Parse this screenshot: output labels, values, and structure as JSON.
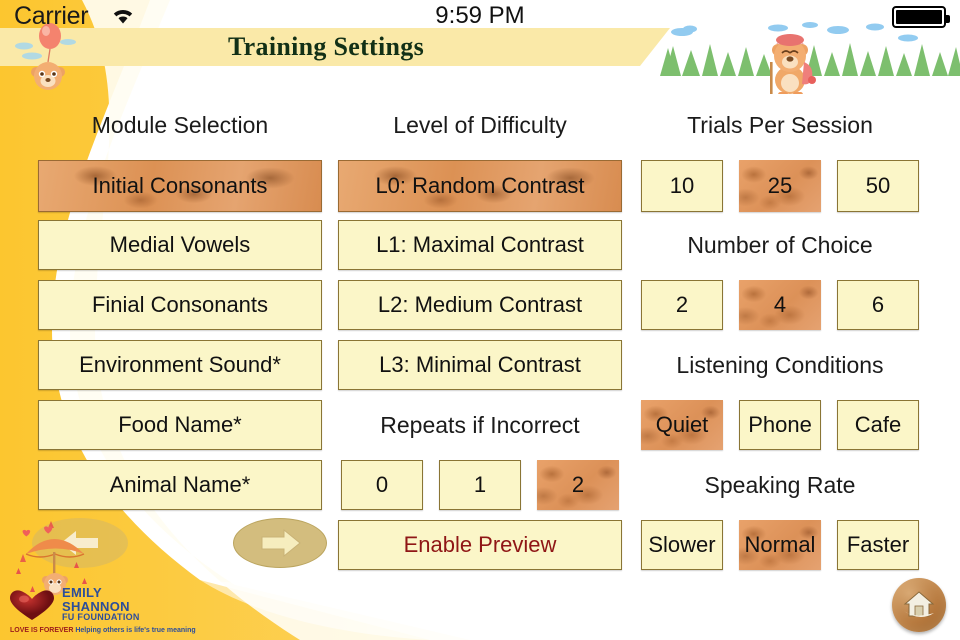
{
  "status_bar": {
    "carrier": "Carrier",
    "wifi_icon": "wifi-icon",
    "time": "9:59 PM",
    "battery_icon": "battery-full-icon"
  },
  "header": {
    "title": "Training Settings",
    "decoration": "forest-bear-scene"
  },
  "colors": {
    "frame": "#fcc638",
    "banner": "#fae9a8",
    "button_bg": "#fbf6c8",
    "button_border": "#8a7535",
    "selected_bg": "#dd9459",
    "title_text": "#123016",
    "preview_text": "#8f1616"
  },
  "columns": {
    "module_selection": {
      "heading": "Module Selection",
      "options": [
        {
          "label": "Initial Consonants",
          "selected": true
        },
        {
          "label": "Medial Vowels",
          "selected": false
        },
        {
          "label": "Finial Consonants",
          "selected": false
        },
        {
          "label": "Environment Sound*",
          "selected": false
        },
        {
          "label": "Food Name*",
          "selected": false
        },
        {
          "label": "Animal Name*",
          "selected": false
        }
      ]
    },
    "level_of_difficulty": {
      "heading": "Level of Difficulty",
      "options": [
        {
          "label": "L0: Random Contrast",
          "selected": true
        },
        {
          "label": "L1: Maximal Contrast",
          "selected": false
        },
        {
          "label": "L2: Medium Contrast",
          "selected": false
        },
        {
          "label": "L3: Minimal Contrast",
          "selected": false
        }
      ]
    },
    "repeats_if_incorrect": {
      "heading": "Repeats if Incorrect",
      "options": [
        {
          "label": "0",
          "selected": false
        },
        {
          "label": "1",
          "selected": false
        },
        {
          "label": "2",
          "selected": true
        }
      ]
    },
    "enable_preview": {
      "label": "Enable Preview",
      "selected": false
    },
    "trials_per_session": {
      "heading": "Trials Per Session",
      "options": [
        {
          "label": "10",
          "selected": false
        },
        {
          "label": "25",
          "selected": true
        },
        {
          "label": "50",
          "selected": false
        }
      ]
    },
    "number_of_choice": {
      "heading": "Number of Choice",
      "options": [
        {
          "label": "2",
          "selected": false
        },
        {
          "label": "4",
          "selected": true
        },
        {
          "label": "6",
          "selected": false
        }
      ]
    },
    "listening_conditions": {
      "heading": "Listening Conditions",
      "options": [
        {
          "label": "Quiet",
          "selected": true
        },
        {
          "label": "Phone",
          "selected": false
        },
        {
          "label": "Cafe",
          "selected": false
        }
      ]
    },
    "speaking_rate": {
      "heading": "Speaking Rate",
      "options": [
        {
          "label": "Slower",
          "selected": false
        },
        {
          "label": "Normal",
          "selected": true
        },
        {
          "label": "Faster",
          "selected": false
        }
      ]
    }
  },
  "footer": {
    "prev_icon": "arrow-left-icon",
    "next_icon": "arrow-right-icon",
    "home_icon": "home-icon",
    "logo": {
      "line1": "EMILY",
      "line2": "SHANNON",
      "line3": "FU FOUNDATION",
      "tagline_a": "LOVE IS FOREVER",
      "tagline_b": "Helping others is life's true meaning"
    }
  }
}
